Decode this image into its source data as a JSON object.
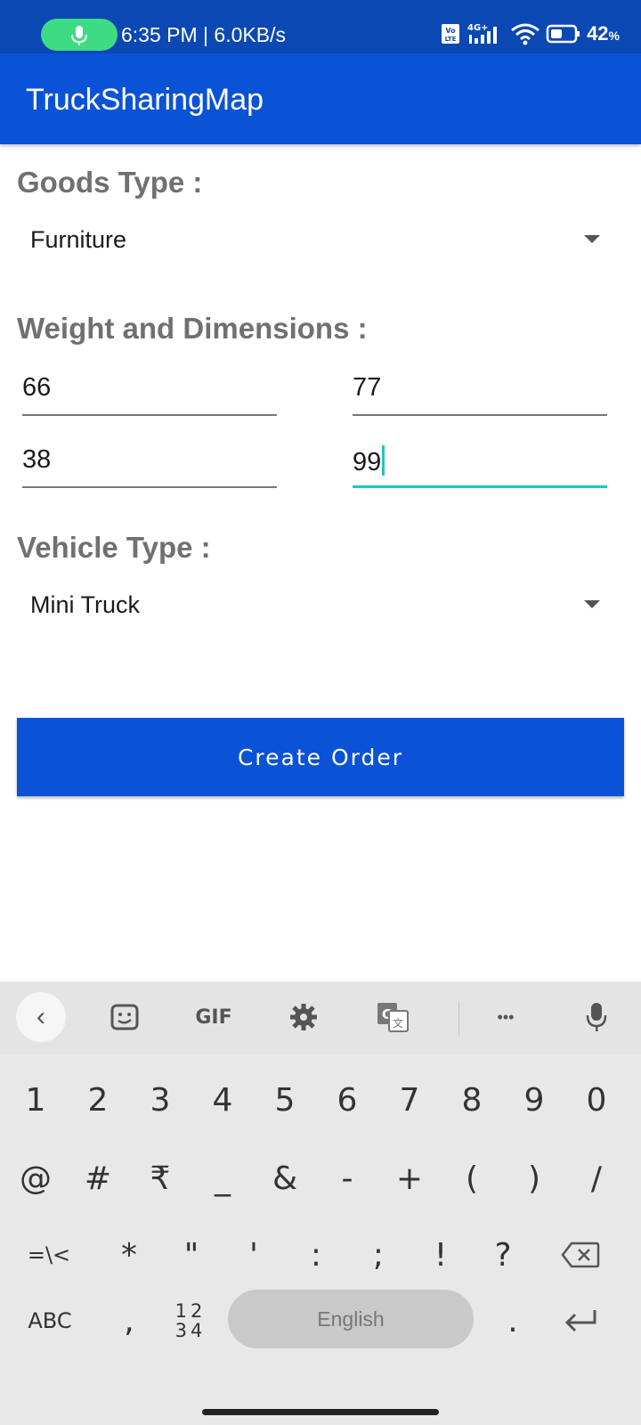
{
  "status_bar": {
    "time_speed": "6:35 PM | 6.0KB/s",
    "battery": "42",
    "battery_unit": "%",
    "network_label": "4G+",
    "volte_label": "Vo LTE",
    "icons": [
      "mic-icon",
      "volte-icon",
      "signal-icon",
      "wifi-icon",
      "battery-icon"
    ]
  },
  "app_bar": {
    "title": "TruckSharingMap"
  },
  "form": {
    "goods_type_label": "Goods Type :",
    "goods_type_value": "Furniture",
    "weight_label": "Weight and Dimensions :",
    "fields": [
      "66",
      "77",
      "38",
      "99"
    ],
    "vehicle_type_label": "Vehicle Type :",
    "vehicle_type_value": "Mini Truck",
    "create_order_label": "Create Order"
  },
  "keyboard": {
    "toolbar": {
      "gif_label": "GIF",
      "more_label": "•••",
      "icons": [
        "back-icon",
        "sticker-icon",
        "gif-icon",
        "settings-icon",
        "translate-icon",
        "more-icon",
        "mic-icon"
      ]
    },
    "row1": [
      "1",
      "2",
      "3",
      "4",
      "5",
      "6",
      "7",
      "8",
      "9",
      "0"
    ],
    "row2": [
      "@",
      "#",
      "₹",
      "_",
      "&",
      "-",
      "+",
      "(",
      ")",
      "/"
    ],
    "row3": [
      "=\\<",
      "*",
      "\"",
      "'",
      ":",
      ";",
      "!",
      "?"
    ],
    "abc_label": "ABC",
    "comma_label": ",",
    "num_toggle_top": "12",
    "num_toggle_bottom": "34",
    "space_label": "English",
    "period_label": "."
  }
}
